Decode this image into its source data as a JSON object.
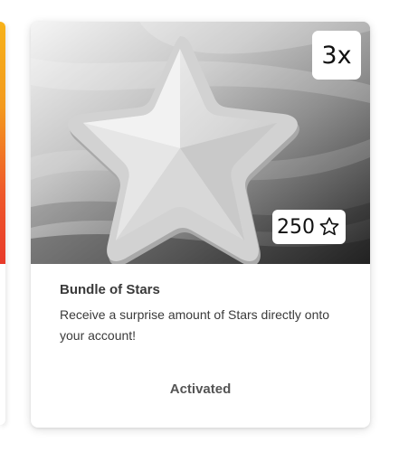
{
  "card": {
    "multiplier": "3x",
    "price": "250",
    "price_icon": "star-outline-icon",
    "image_icon": "star-icon",
    "title": "Bundle of Stars",
    "description": "Receive a surprise amount of Stars directly onto your account!",
    "status": "Activated"
  },
  "colors": {
    "star_fill": "#e4e4e4",
    "badge_bg": "#ffffff",
    "title_text": "#3a3a3a",
    "status_text": "#555555"
  }
}
